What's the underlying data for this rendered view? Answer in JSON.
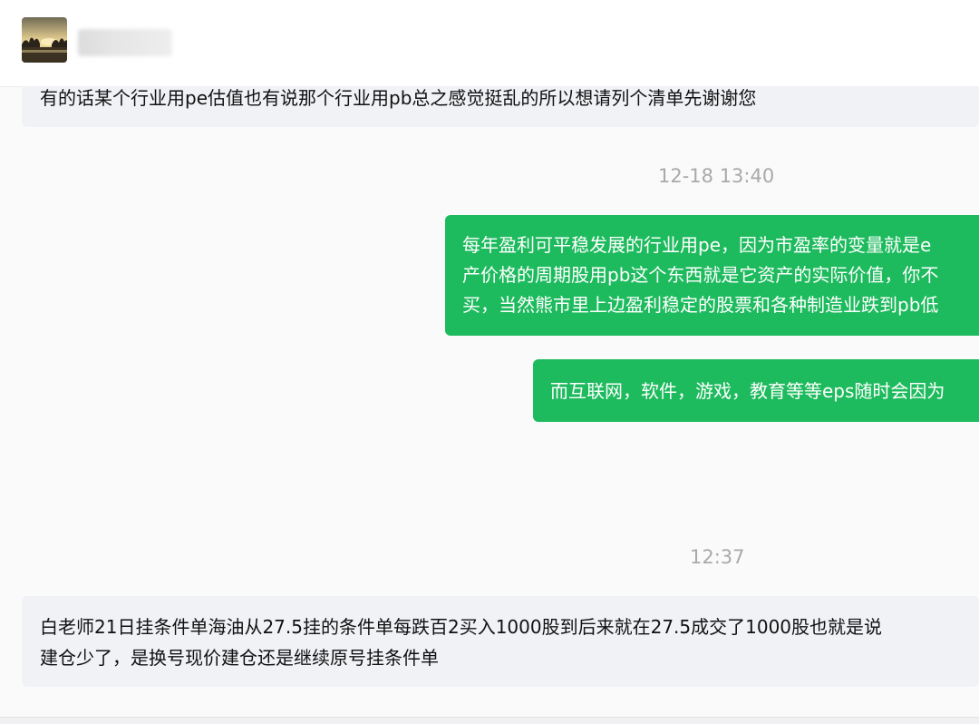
{
  "header": {
    "avatar_icon": "landscape-photo-avatar",
    "contact_name": ""
  },
  "messages": {
    "incoming_1": {
      "text": "有的话某个行业用pe估值也有说那个行业用pb总之感觉挺乱的所以想请列个清单先谢谢您"
    },
    "timestamp_1": "12-18 13:40",
    "outgoing_1": {
      "lines": [
        "每年盈利可平稳发展的行业用pe，因为市盈率的变量就是e",
        "产价格的周期股用pb这个东西就是它资产的实际价值，你不",
        "买，当然熊市里上边盈利稳定的股票和各种制造业跌到pb低"
      ]
    },
    "outgoing_2": {
      "text": "而互联网，软件，游戏，教育等等eps随时会因为"
    },
    "timestamp_2": "12:37",
    "incoming_2": {
      "lines": [
        "白老师21日挂条件单海油从27.5挂的条件单每跌百2买入1000股到后来就在27.5成交了1000股也就是说",
        "建仓少了，是换号现价建仓还是继续原号挂条件单"
      ]
    }
  },
  "colors": {
    "outgoing_bubble": "#1ebb5e",
    "incoming_bubble": "#f1f2f6",
    "timestamp": "#a9a9a9"
  }
}
